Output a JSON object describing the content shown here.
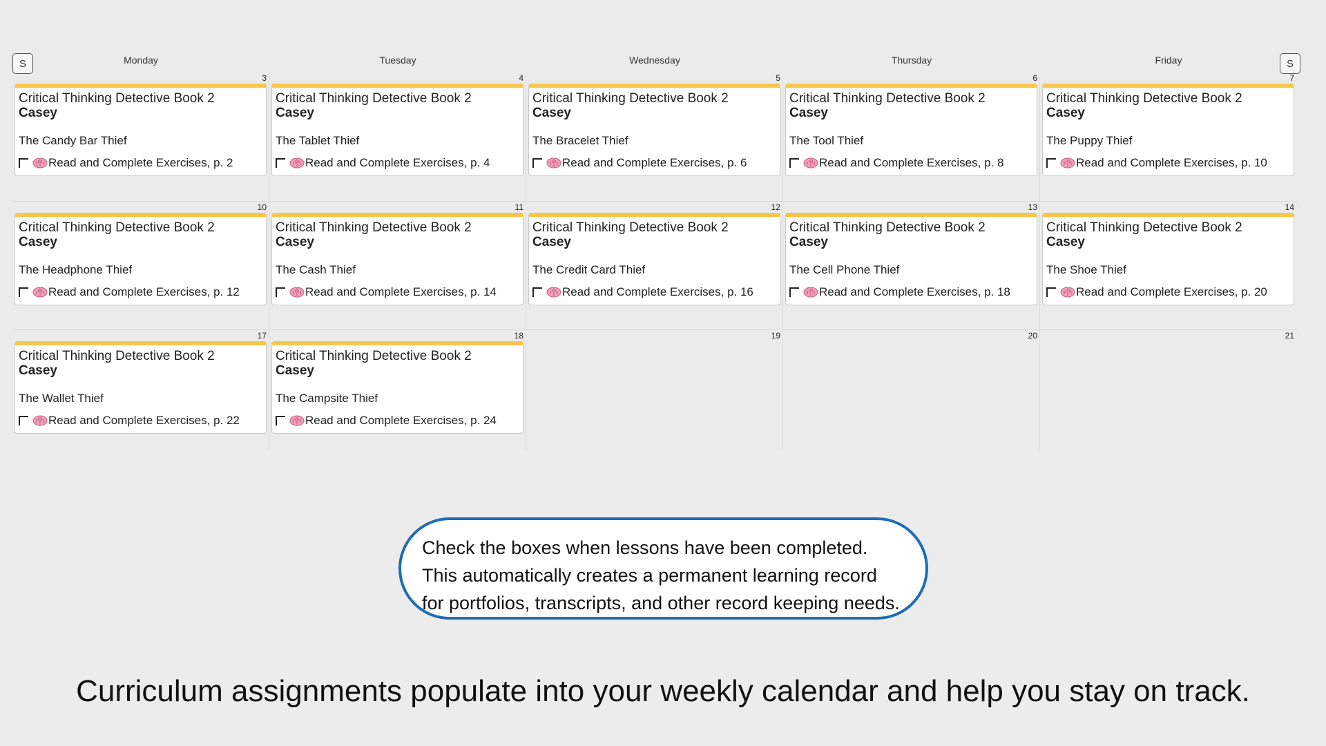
{
  "header": {
    "prev_toggle": "S",
    "next_toggle": "S",
    "days": [
      "Monday",
      "Tuesday",
      "Wednesday",
      "Thursday",
      "Friday"
    ]
  },
  "colors": {
    "card_accent": "#f7c64b",
    "callout_border": "#1e6db5"
  },
  "weeks": [
    {
      "cells": [
        {
          "date": "3",
          "entry": {
            "title": "Critical Thinking Detective Book 2",
            "student": "Casey",
            "lesson": "The Candy Bar Thief",
            "task": "Read and Complete Exercises, p. 2",
            "task_icon": "brain-icon",
            "completed": false
          }
        },
        {
          "date": "4",
          "entry": {
            "title": "Critical Thinking Detective Book 2",
            "student": "Casey",
            "lesson": "The Tablet Thief",
            "task": "Read and Complete Exercises, p. 4",
            "task_icon": "brain-icon",
            "completed": false
          }
        },
        {
          "date": "5",
          "entry": {
            "title": "Critical Thinking Detective Book 2",
            "student": "Casey",
            "lesson": "The Bracelet Thief",
            "task": "Read and Complete Exercises, p. 6",
            "task_icon": "brain-icon",
            "completed": false
          }
        },
        {
          "date": "6",
          "entry": {
            "title": "Critical Thinking Detective Book 2",
            "student": "Casey",
            "lesson": "The Tool Thief",
            "task": "Read and Complete Exercises, p. 8",
            "task_icon": "brain-icon",
            "completed": false
          }
        },
        {
          "date": "7",
          "entry": {
            "title": "Critical Thinking Detective Book 2",
            "student": "Casey",
            "lesson": "The Puppy Thief",
            "task": "Read and Complete Exercises, p. 10",
            "task_icon": "brain-icon",
            "completed": false
          }
        }
      ]
    },
    {
      "cells": [
        {
          "date": "10",
          "entry": {
            "title": "Critical Thinking Detective Book 2",
            "student": "Casey",
            "lesson": "The Headphone Thief",
            "task": "Read and Complete Exercises, p. 12",
            "task_icon": "brain-icon",
            "completed": false
          }
        },
        {
          "date": "11",
          "entry": {
            "title": "Critical Thinking Detective Book 2",
            "student": "Casey",
            "lesson": "The Cash Thief",
            "task": "Read and Complete Exercises, p. 14",
            "task_icon": "brain-icon",
            "completed": false
          }
        },
        {
          "date": "12",
          "entry": {
            "title": "Critical Thinking Detective Book 2",
            "student": "Casey",
            "lesson": "The Credit Card Thief",
            "task": "Read and Complete Exercises, p. 16",
            "task_icon": "brain-icon",
            "completed": false
          }
        },
        {
          "date": "13",
          "entry": {
            "title": "Critical Thinking Detective Book 2",
            "student": "Casey",
            "lesson": "The Cell Phone Thief",
            "task": "Read and Complete Exercises, p. 18",
            "task_icon": "brain-icon",
            "completed": false
          }
        },
        {
          "date": "14",
          "entry": {
            "title": "Critical Thinking Detective Book 2",
            "student": "Casey",
            "lesson": "The Shoe Thief",
            "task": "Read and Complete Exercises, p. 20",
            "task_icon": "brain-icon",
            "completed": false
          }
        }
      ]
    },
    {
      "cells": [
        {
          "date": "17",
          "entry": {
            "title": "Critical Thinking Detective Book 2",
            "student": "Casey",
            "lesson": "The Wallet Thief",
            "task": "Read and Complete Exercises, p. 22",
            "task_icon": "brain-icon",
            "completed": false
          }
        },
        {
          "date": "18",
          "entry": {
            "title": "Critical Thinking Detective Book 2",
            "student": "Casey",
            "lesson": "The Campsite Thief",
            "task": "Read and Complete Exercises, p. 24",
            "task_icon": "brain-icon",
            "completed": false
          }
        },
        {
          "date": "19",
          "entry": null
        },
        {
          "date": "20",
          "entry": null
        },
        {
          "date": "21",
          "entry": null
        }
      ]
    }
  ],
  "callout": {
    "lines": [
      "Check the boxes when lessons have been completed.",
      "This automatically creates a permanent learning record",
      "for portfolios, transcripts, and other record keeping needs."
    ]
  },
  "caption": "Curriculum assignments populate into your weekly calendar and help you stay on track."
}
